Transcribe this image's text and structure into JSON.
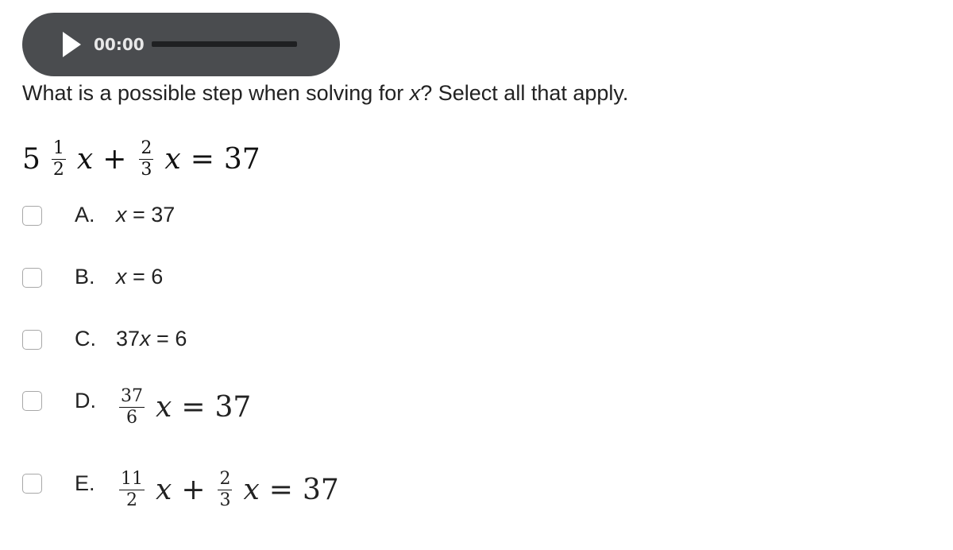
{
  "audio_player": {
    "time": "00:00"
  },
  "question": {
    "prefix": "What is a possible step when solving for ",
    "variable": "x",
    "suffix": "? Select all that apply."
  },
  "equation": {
    "whole": "5",
    "f1_num": "1",
    "f1_den": "2",
    "var": "x",
    "plus": "+",
    "f2_num": "2",
    "f2_den": "3",
    "equals": "=",
    "rhs": "37"
  },
  "options": [
    {
      "letter": "A.",
      "pre": "",
      "var": "x",
      "post": " = 37"
    },
    {
      "letter": "B.",
      "pre": "",
      "var": "x",
      "post": " = 6"
    },
    {
      "letter": "C.",
      "pre": "37",
      "var": "x",
      "post": " = 6"
    },
    {
      "letter": "D.",
      "num": "37",
      "den": "6",
      "var": "x",
      "equals": "=",
      "rhs": "37"
    },
    {
      "letter": "E.",
      "num": "11",
      "den": "2",
      "var": "x",
      "plus": "+",
      "num2": "2",
      "den2": "3",
      "equals": "=",
      "rhs": "37"
    }
  ]
}
